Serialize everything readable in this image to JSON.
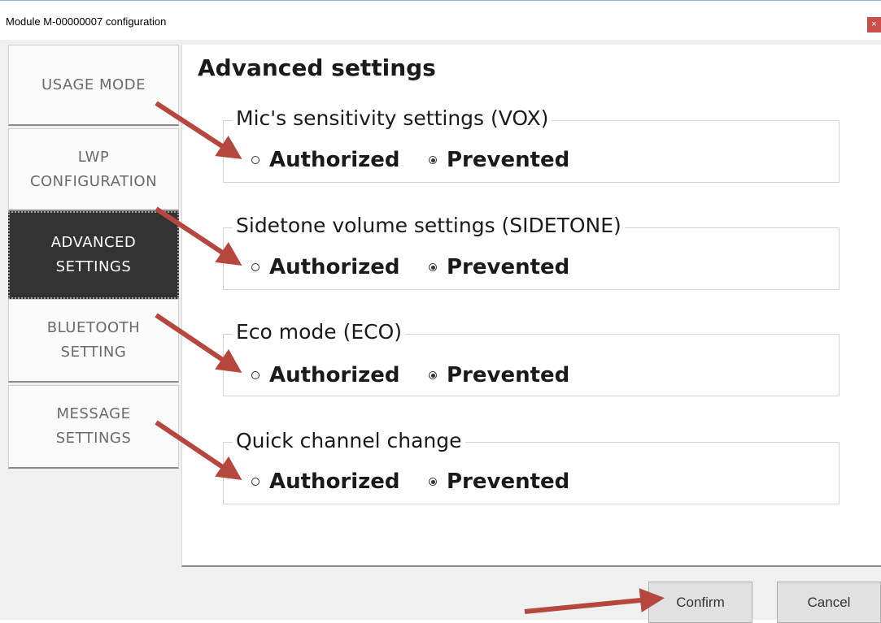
{
  "window": {
    "title": "Module M-00000007 configuration",
    "close_glyph": "×"
  },
  "tabs": [
    {
      "label": "USAGE MODE",
      "active": false
    },
    {
      "label": "LWP\nCONFIGURATION",
      "active": false
    },
    {
      "label": "ADVANCED\nSETTINGS",
      "active": true
    },
    {
      "label": "BLUETOOTH\nSETTING",
      "active": false
    },
    {
      "label": "MESSAGE\nSETTINGS",
      "active": false
    }
  ],
  "main": {
    "title": "Advanced settings",
    "groups": [
      {
        "legend": "Mic's sensitivity settings (VOX)",
        "options": [
          {
            "label": "Authorized",
            "selected": false
          },
          {
            "label": "Prevented",
            "selected": true
          }
        ]
      },
      {
        "legend": "Sidetone volume settings (SIDETONE)",
        "options": [
          {
            "label": "Authorized",
            "selected": false
          },
          {
            "label": "Prevented",
            "selected": true
          }
        ]
      },
      {
        "legend": "Eco mode (ECO)",
        "options": [
          {
            "label": "Authorized",
            "selected": false
          },
          {
            "label": "Prevented",
            "selected": true
          }
        ]
      },
      {
        "legend": "Quick channel change",
        "options": [
          {
            "label": "Authorized",
            "selected": false
          },
          {
            "label": "Prevented",
            "selected": true
          }
        ]
      }
    ]
  },
  "footer": {
    "confirm_label": "Confirm",
    "cancel_label": "Cancel"
  },
  "colors": {
    "annotation_arrow": "#b5473f",
    "active_tab_bg": "#333333",
    "close_button": "#c8504a"
  }
}
